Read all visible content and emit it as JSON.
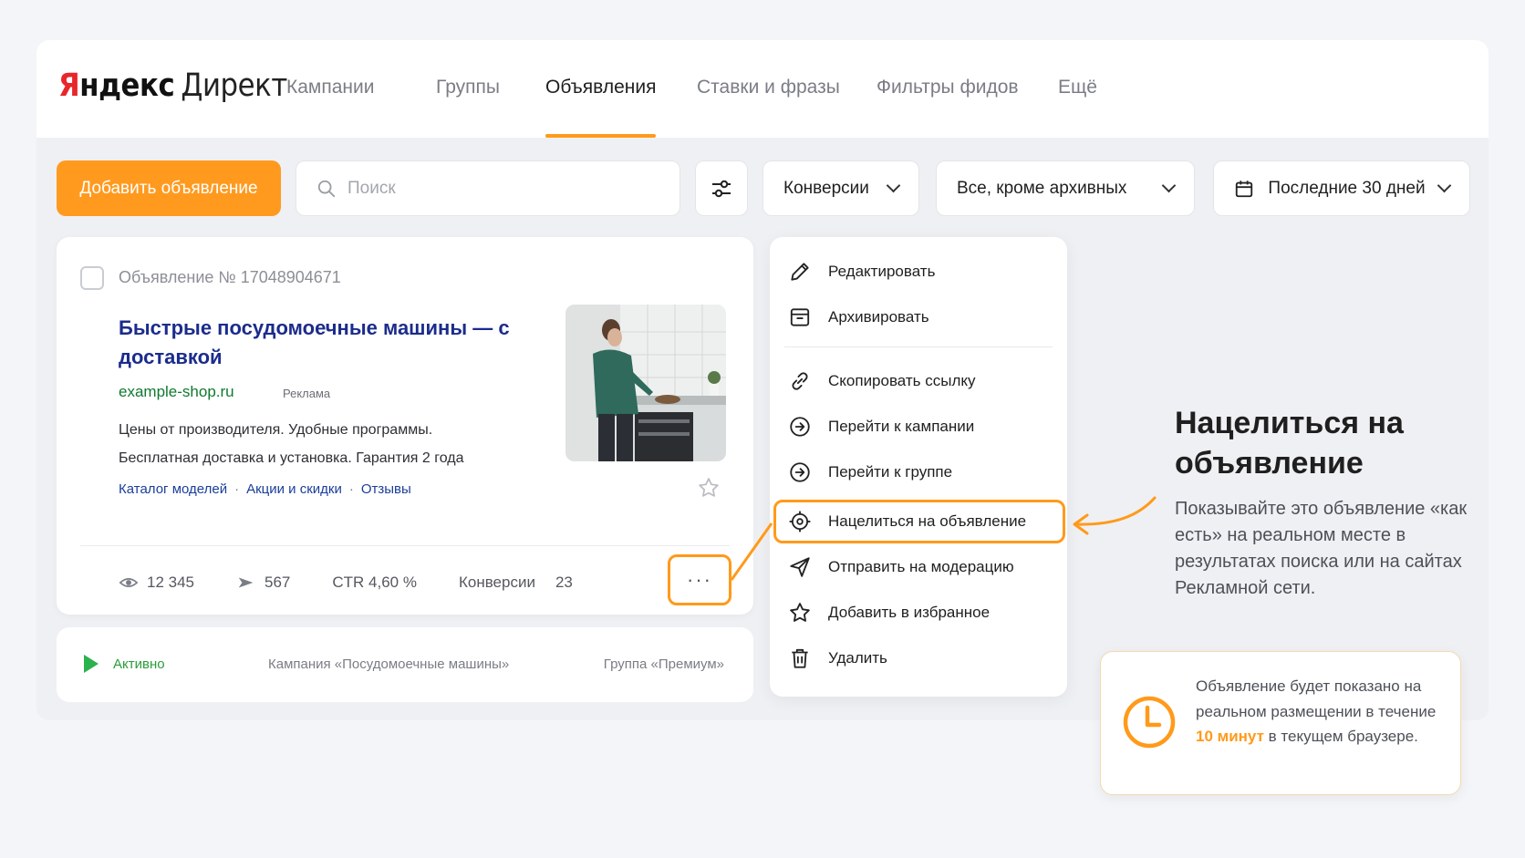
{
  "header": {
    "logo_ya_first": "Я",
    "logo_ya_rest": "ндекс",
    "logo_product": "Директ",
    "tabs": [
      {
        "label": "Кампании"
      },
      {
        "label": "Группы"
      },
      {
        "label": "Объявления"
      },
      {
        "label": "Ставки и фразы"
      },
      {
        "label": "Фильтры фидов"
      },
      {
        "label": "Ещё"
      }
    ]
  },
  "toolbar": {
    "add_label": "Добавить объявление",
    "search_placeholder": "Поиск",
    "metric_select": "Конверсии",
    "status_select": "Все, кроме архивных",
    "period_select": "Последние 30 дней"
  },
  "ad": {
    "number": "Объявление № 17048904671",
    "title": "Быстрые посудомоечные машины — с доставкой",
    "domain": "example-shop.ru",
    "label": "Реклама",
    "text": "Цены от производителя. Удобные программы. Бесплатная доставка и установка. Гарантия 2 года",
    "links": [
      "Каталог моделей",
      "Акции и скидки",
      "Отзывы"
    ],
    "link_separator": "·",
    "stats": {
      "views": "12 345",
      "clicks": "567",
      "ctr": "CTR 4,60 %",
      "conversions_label": "Конверсии",
      "conversions_value": "23"
    },
    "more_label": "···"
  },
  "status_bar": {
    "status": "Активно",
    "campaign": "Кампания «Посудомоечные машины»",
    "group": "Группа «Премиум»"
  },
  "menu": {
    "items": [
      {
        "label": "Редактировать",
        "icon": "pencil-icon"
      },
      {
        "label": "Архивировать",
        "icon": "archive-icon"
      },
      {
        "label": "Скопировать ссылку",
        "icon": "link-icon"
      },
      {
        "label": "Перейти к кампании",
        "icon": "arrow-circle-icon"
      },
      {
        "label": "Перейти к группе",
        "icon": "arrow-circle-icon"
      },
      {
        "label": "Нацелиться на объявление",
        "icon": "target-icon"
      },
      {
        "label": "Отправить на модерацию",
        "icon": "send-icon"
      },
      {
        "label": "Добавить в избранное",
        "icon": "star-icon"
      },
      {
        "label": "Удалить",
        "icon": "trash-icon"
      }
    ]
  },
  "callout": {
    "title": "Нацелиться на объявление",
    "text": "Показывайте это объявление «как есть» на реальном месте в результатах поиска или на сайтах Рекламной сети."
  },
  "notice": {
    "text_before": "Объявление будет показано на реальном размещении в течение ",
    "accent": "10 минут",
    "text_after": " в текущем браузере."
  },
  "colors": {
    "accent": "#ff9a1a",
    "logo_red": "#e8262b",
    "title_blue": "#1b2c8c",
    "domain_green": "#0f7a2e",
    "status_green": "#2bb24c"
  }
}
